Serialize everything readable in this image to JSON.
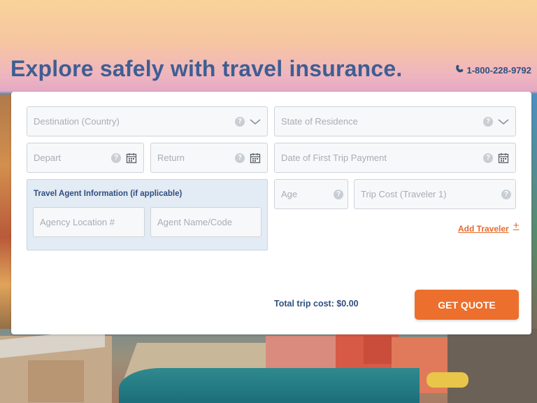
{
  "hero": {
    "title": "Explore safely with travel insurance.",
    "phone": "1-800-228-9792"
  },
  "form": {
    "destination_placeholder": "Destination (Country)",
    "state_placeholder": "State of Residence",
    "depart_placeholder": "Depart",
    "return_placeholder": "Return",
    "first_payment_placeholder": "Date of First Trip Payment",
    "age_placeholder": "Age",
    "trip_cost_placeholder": "Trip Cost (Traveler 1)",
    "help_glyph": "?"
  },
  "agent": {
    "title": "Travel Agent Information (if applicable)",
    "location_placeholder": "Agency Location #",
    "name_placeholder": "Agent Name/Code"
  },
  "actions": {
    "add_traveler": "Add Traveler",
    "add_symbol": "+",
    "total_label": "Total trip cost: $0.00",
    "quote_button": "GET QUOTE"
  },
  "colors": {
    "brand_blue": "#3e5e94",
    "accent_orange": "#ec6f2d"
  },
  "icons": [
    "phone-icon",
    "help-icon",
    "chevron-down-icon",
    "calendar-icon",
    "plus-icon"
  ]
}
